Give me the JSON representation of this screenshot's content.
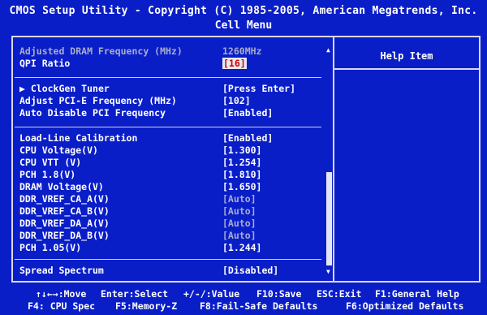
{
  "header": {
    "title": "CMOS Setup Utility - Copyright (C) 1985-2005, American Megatrends, Inc.",
    "menu": "Cell Menu"
  },
  "help": {
    "title": "Help Item"
  },
  "group1": [
    {
      "label": "Adjusted DRAM Frequency (MHz)",
      "value": "1260MHz"
    },
    {
      "label": "QPI Ratio",
      "value": "[16]"
    }
  ],
  "group2": [
    {
      "label": "ClockGen Tuner",
      "value": "[Press Enter]"
    },
    {
      "label": "Adjust PCI-E Frequency (MHz)",
      "value": "[102]"
    },
    {
      "label": "Auto Disable PCI Frequency",
      "value": "[Enabled]"
    }
  ],
  "group3": [
    {
      "label": "Load-Line Calibration",
      "value": "[Enabled]"
    },
    {
      "label": "CPU Voltage(V)",
      "value": "[1.300]"
    },
    {
      "label": "CPU VTT (V)",
      "value": "[1.254]"
    },
    {
      "label": "PCH 1.8(V)",
      "value": "[1.810]"
    },
    {
      "label": "DRAM Voltage(V)",
      "value": "[1.650]"
    },
    {
      "label": "DDR_VREF_CA_A(V)",
      "value": "[Auto]"
    },
    {
      "label": "DDR_VREF_CA_B(V)",
      "value": "[Auto]"
    },
    {
      "label": "DDR_VREF_DA_A(V)",
      "value": "[Auto]"
    },
    {
      "label": "DDR_VREF_DA_B(V)",
      "value": "[Auto]"
    },
    {
      "label": "PCH 1.05(V)",
      "value": "[1.244]"
    }
  ],
  "group4": [
    {
      "label": "Spread Spectrum",
      "value": "[Disabled]"
    }
  ],
  "footer": {
    "move": "↑↓←→:Move",
    "select": "Enter:Select",
    "value": "+/-/:Value",
    "save": "F10:Save",
    "exit": "ESC:Exit",
    "help": "F1:General Help",
    "cpu_spec": "F4: CPU Spec",
    "memory": "F5:Memory-Z",
    "failsafe": "F8:Fail-Safe Defaults",
    "optimized": "F6:Optimized Defaults"
  }
}
